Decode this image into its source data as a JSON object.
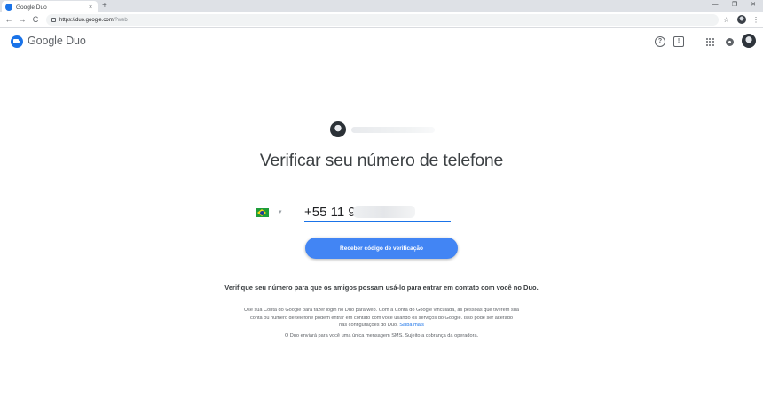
{
  "browser": {
    "tab_title": "Google Duo",
    "tab_close": "×",
    "new_tab": "+",
    "window_controls": [
      "—",
      "❐",
      "✕"
    ],
    "url_host": "https://duo.google.com",
    "url_path": "/?web",
    "nav_back": "←",
    "nav_forward": "→",
    "nav_reload": "C",
    "star": "☆",
    "menu": "⋮"
  },
  "app": {
    "name": "Google Duo",
    "help": "?",
    "feedback": "!"
  },
  "main": {
    "title": "Verificar seu número de telefone",
    "phone_prefix": "+55 11 9",
    "country_caret": "▾",
    "send_button": "Receber código de verificação",
    "info_heading": "Verifique seu número para que os amigos possam usá-lo para entrar em contato com você no Duo.",
    "info_line1": "Use sua Conta do Google para fazer login no Duo para web. Com a Conta do Google vinculada, as pessoas que tiverem sua",
    "info_line2": "conta ou número de telefone podem entrar em contato com você usando os serviços do Google. Isso pode ser alterado",
    "info_line3": "nas configurações do Duo.",
    "learn_more": "Saiba mais",
    "sms_note": "O Duo enviará para você uma única mensagem SMS. Sujeito a cobrança da operadora."
  },
  "colors": {
    "accent": "#1a73e8",
    "button": "#4285f4"
  }
}
